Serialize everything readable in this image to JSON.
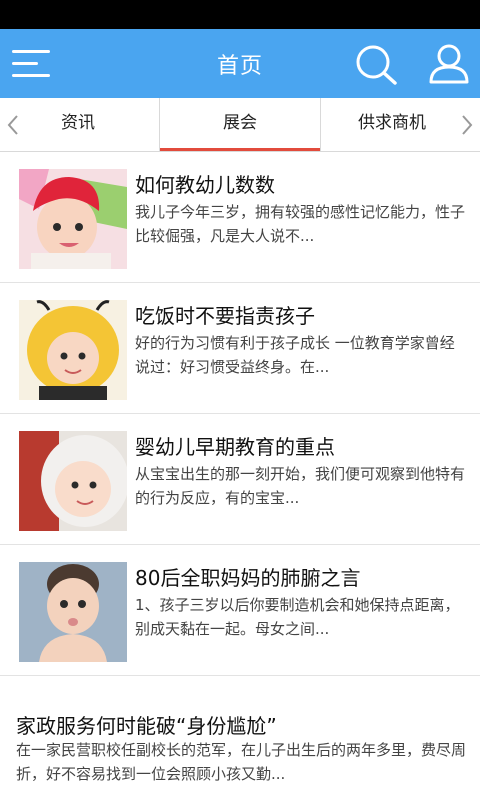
{
  "header": {
    "title": "首页",
    "accent_color": "#4aa5f0",
    "menu_icon": "menu-icon",
    "search_icon": "search-icon",
    "user_icon": "user-icon"
  },
  "tabs": [
    {
      "label": "资讯",
      "active": false
    },
    {
      "label": "展会",
      "active": true
    },
    {
      "label": "供求商机",
      "active": false
    }
  ],
  "active_tab_color": "#e24b3c",
  "articles": [
    {
      "title": "如何教幼儿数数",
      "summary": "我儿子今年三岁，拥有较强的感性记忆能力，性子比较倔强，凡是大人说不..."
    },
    {
      "title": "吃饭时不要指责孩子",
      "summary": "好的行为习惯有利于孩子成长 一位教育学家曾经说过：好习惯受益终身。在..."
    },
    {
      "title": "婴幼儿早期教育的重点",
      "summary": "从宝宝出生的那一刻开始，我们便可观察到他特有的行为反应，有的宝宝..."
    },
    {
      "title": "80后全职妈妈的肺腑之言",
      "summary": "1、孩子三岁以后你要制造机会和她保持点距离，别成天黏在一起。母女之间..."
    },
    {
      "title": "家政服务何时能破“身份尴尬”",
      "summary": "在一家民营职校任副校长的范军，在儿子出生后的两年多里，费尽周折，好不容易找到一位会照顾小孩又勤..."
    }
  ]
}
